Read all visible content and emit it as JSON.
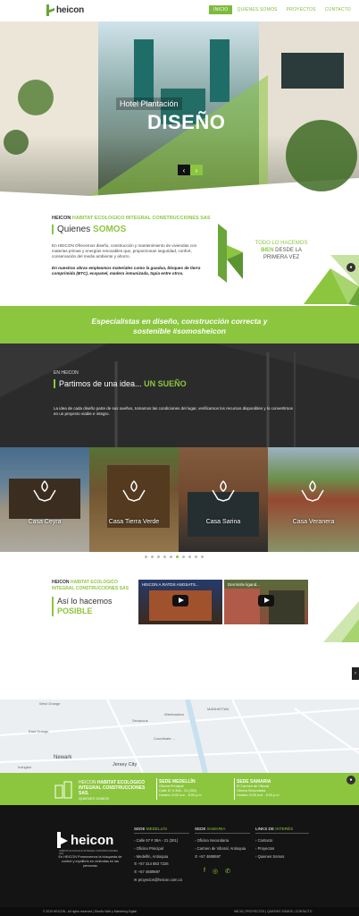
{
  "header": {
    "logo_text": "heicon",
    "nav": [
      "INICIO",
      "QUIENES SOMOS",
      "PROYECTOS",
      "CONTACTO"
    ]
  },
  "hero": {
    "subtitle": "Hotel Plantación",
    "title": "DISEÑO",
    "prev": "‹",
    "next": "›"
  },
  "about": {
    "kicker_a": "HEICON",
    "kicker_b": "HABITAT ECOLOGICO INTEGRAL CONSTRUCCIONES SAS",
    "heading_a": "Quienes",
    "heading_b": "SOMOS",
    "p1": "En HEICON Ofrecemos diseño, construcción y mantenimiento de viviendas con materias primas y energías renovables que, proporcionan seguridad, confort, conservación del medio ambiente y ahorro.",
    "p2": "En nuestras obras empleamos materiales como la guadua, bloques de tierra comprimida (BTC), ecopanel, madera inmunizada, tapia entre otros.",
    "side_a": "TODO LO HACEMOS",
    "side_b": "BIEN",
    "side_c": "DESDE LA PRIMERA VEZ"
  },
  "band": {
    "line1": "Especialistas en diseño, construcción correcta y",
    "line2": "sostenible #somosheicon"
  },
  "idea": {
    "kicker": "EN HEICON",
    "title_a": "Partimos de una idea...",
    "title_b": "UN SUEÑO",
    "p": "La idea de cada diseño parte de sus sueños, tomamos las condiciones del lugar, verificamos los recursos disponibles y lo convertimos en un proyecto viable e integro."
  },
  "projects": [
    "Casa Ceyra",
    "Casa Tierra Verde",
    "Casa Sarina",
    "Casa Veranera"
  ],
  "possible": {
    "kicker_a": "HEICON",
    "kicker_b": "HABITAT ECOLOGICO INTEGRAL CONSTRUCCIONES SAS",
    "title_a": "Así lo hacemos",
    "title_b": "POSIBLE",
    "video1": "HEICON A.RATDS ANGSATS...",
    "video2": "Derrimitiv ligand..."
  },
  "map": {
    "labels": [
      "West Orange",
      "East Orange",
      "Newark",
      "Irvington",
      "Secaucus",
      "Jersey City",
      "MANHATTAN",
      "Weehawken",
      "Coordinate ..."
    ]
  },
  "info": {
    "brand_a": "HEICON",
    "brand_b": "HABITAT ECOLOGICO INTEGRAL CONSTRUCCIONES SAS.",
    "brand_c": "QUIENES SOMOS",
    "sede1_h": "SEDE MEDELLÍN",
    "sede1": [
      "Oficina Principal",
      "Calle 57 # 39A - 21 (301)",
      "Horario: 8:00 a.m - 6:00 p.m"
    ],
    "sede2_h": "SEDE SAMARIA",
    "sede2": [
      "El Carmen de Viboral",
      "Oficina Secundaria",
      "Horario: 8:00 a.m - 6:00 p.m"
    ]
  },
  "footer": {
    "logo_text": "heicon",
    "logo_sub": "HABITAT ECOLOGICO INTEGRAL CONSTRUCCIONES SAS",
    "about": "En HEICON Promovemos la búsqueda de confort y equilibrio en viviendas en las personas",
    "col1_h_a": "SEDE",
    "col1_h_b": "MEDELLÍN",
    "col1": [
      "Calle 57 # 39A - 21 (301)",
      "Oficina Principal",
      "Medellín, Antioquia",
      "+57 314 883 7226",
      "+57 4689597",
      "proyectos@heicon.com.co"
    ],
    "col2_h_a": "SEDE",
    "col2_h_b": "SAMARIA",
    "col2": [
      "Oficina Secundaria",
      "Carmen de Viboral, Antioquia",
      "+57 4689597"
    ],
    "col3_h_a": "LINKS DE",
    "col3_h_b": "INTERÉS",
    "col3": [
      "Contacto",
      "Proyectos",
      "Quienes Somos"
    ],
    "copyright": "© 2019 HEICON - All rights reserved | Diseño Web y Marketing Digital ",
    "bottom_nav": "INICIO | PROYECTOS | QUIENES SOMOS | CONTACTO"
  },
  "colors": {
    "accent": "#8cc63f",
    "dark": "#141414"
  }
}
